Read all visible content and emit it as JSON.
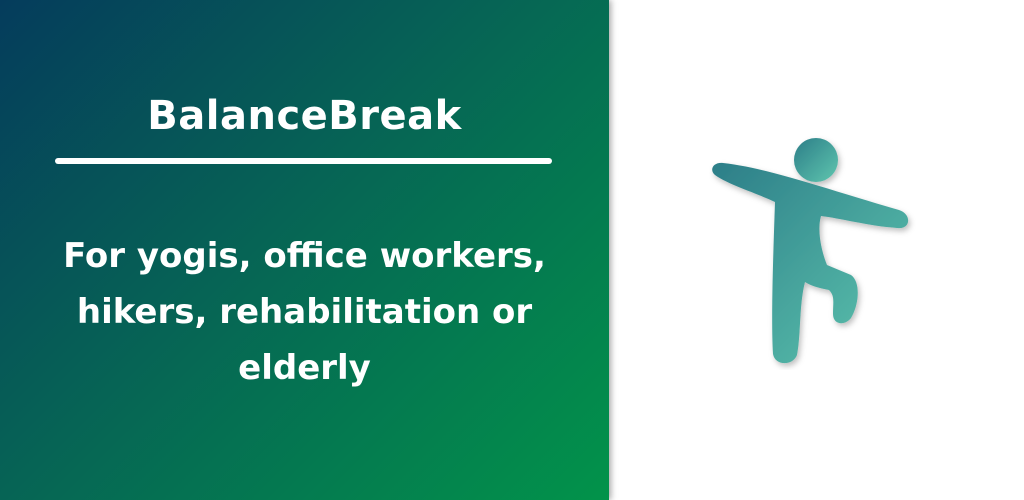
{
  "banner": {
    "title": "BalanceBreak",
    "tagline": "For yogis, office workers,\nhikers, rehabilitation or\nelderly",
    "logo_icon": "balancing-person-icon"
  },
  "colors": {
    "gradient_start": "#053c5c",
    "gradient_end": "#02934a",
    "logo_light": "#5cc3ad",
    "logo_dark": "#2c7e88",
    "text": "#ffffff"
  }
}
